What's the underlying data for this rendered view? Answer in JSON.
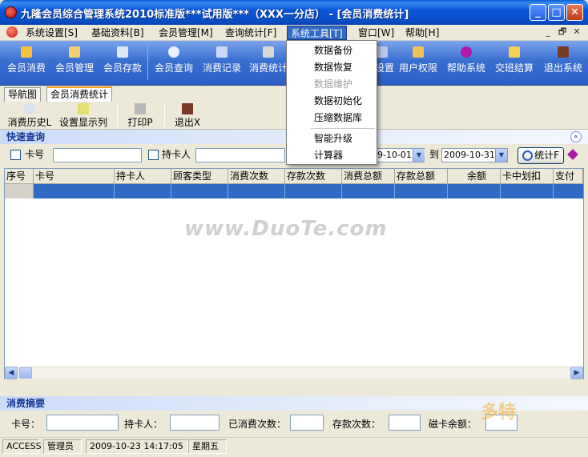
{
  "window": {
    "title": "九隆会员综合管理系统2010标准版***试用版***（XXX一分店）  - [会员消费统计]",
    "controls": {
      "minimize": "_",
      "maximize": "□",
      "close": "✕"
    }
  },
  "menubar": {
    "items": [
      "系统设置[S]",
      "基础资料[B]",
      "会员管理[M]",
      "查询统计[F]",
      "系统工具[T]",
      "窗口[W]",
      "帮助[H]"
    ],
    "mdi_controls": [
      "_",
      "🗗",
      "✕"
    ]
  },
  "toolbar": {
    "buttons": [
      "会员消费",
      "会员管理",
      "会员存款",
      "会员查询",
      "消费记录",
      "消费统计",
      "设置",
      "用户权限",
      "帮助系统",
      "交班结算",
      "退出系统"
    ]
  },
  "dropdown": {
    "items": [
      "数据备份",
      "数据恢复",
      "数据维护",
      "数据初始化",
      "压缩数据库",
      "智能升级",
      "计算器"
    ],
    "disabled": [
      "数据维护"
    ]
  },
  "tabs": [
    "导航图",
    "会员消费统计"
  ],
  "subtoolbar": [
    "消费历史L",
    "设置显示列",
    "打印P",
    "退出X"
  ],
  "quick_search": {
    "title": "快速查询",
    "card_label": "卡号",
    "holder_label": "持卡人",
    "date_from": "9-10-01",
    "to_label": "到",
    "date_to": "2009-10-31",
    "stats_button": "统计F",
    "collapse_icon": "«"
  },
  "grid": {
    "columns": [
      "序号",
      "卡号",
      "持卡人",
      "顾客类型",
      "消费次数",
      "存款次数",
      "消费总额",
      "存款总额",
      "余额",
      "卡中划扣",
      "支付"
    ],
    "watermark": "www.DuoTe.com"
  },
  "summary": {
    "title": "消费摘要",
    "fields": [
      "卡号：",
      "持卡人：",
      "已消费次数：",
      "存款次数：",
      "磁卡余额："
    ]
  },
  "statusbar": {
    "db": "ACCESS",
    "user": "管理员",
    "datetime": "2009-10-23 14:17:05",
    "weekday": "星期五"
  },
  "brand": {
    "watermark_logo": "多特"
  },
  "colors": {
    "selection": "#316ac5",
    "title": "#0a4dc4",
    "section_text": "#17399a"
  }
}
